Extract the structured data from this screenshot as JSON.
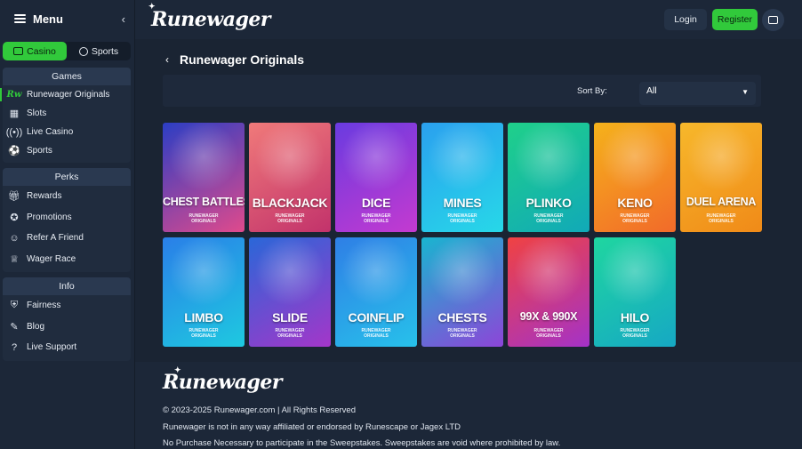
{
  "sidebar": {
    "title": "Menu",
    "modes": [
      {
        "label": "Casino",
        "active": true
      },
      {
        "label": "Sports",
        "active": false
      }
    ],
    "sections": [
      {
        "title": "Games",
        "items": [
          {
            "label": "Runewager Originals",
            "icon": "runewager-icon",
            "active": true
          },
          {
            "label": "Slots",
            "icon": "slots-icon"
          },
          {
            "label": "Live Casino",
            "icon": "live-casino-icon"
          },
          {
            "label": "Sports",
            "icon": "sports-ball-icon"
          }
        ]
      },
      {
        "title": "Perks",
        "items": [
          {
            "label": "Rewards",
            "icon": "gift-icon"
          },
          {
            "label": "Promotions",
            "icon": "promotions-icon"
          },
          {
            "label": "Refer A Friend",
            "icon": "refer-friend-icon"
          },
          {
            "label": "Wager Race",
            "icon": "trophy-icon"
          }
        ]
      },
      {
        "title": "Info",
        "items": [
          {
            "label": "Fairness",
            "icon": "shield-check-icon"
          },
          {
            "label": "Blog",
            "icon": "blog-icon"
          },
          {
            "label": "Live Support",
            "icon": "help-icon"
          }
        ]
      }
    ]
  },
  "header": {
    "logo": "Runewager",
    "login": "Login",
    "register": "Register"
  },
  "main": {
    "title": "Runewager Originals",
    "sort_label": "Sort By:",
    "sort_value": "All",
    "games": [
      {
        "name": "CHEST BATTLES",
        "sub": "RUNEWAGER\nORIGINALS",
        "colors": [
          "#2b3ec4",
          "#e04a8c"
        ]
      },
      {
        "name": "BLACKJACK",
        "sub": "RUNEWAGER\nORIGINALS",
        "colors": [
          "#f07a7a",
          "#c2326b"
        ]
      },
      {
        "name": "DICE",
        "sub": "RUNEWAGER\nORIGINALS",
        "colors": [
          "#6a3be0",
          "#c43ad0"
        ]
      },
      {
        "name": "MINES",
        "sub": "RUNEWAGER\nORIGINALS",
        "colors": [
          "#2aa0ef",
          "#27d8e8"
        ]
      },
      {
        "name": "PLINKO",
        "sub": "RUNEWAGER\nORIGINALS",
        "colors": [
          "#1fd08a",
          "#11a9b8"
        ]
      },
      {
        "name": "KENO",
        "sub": "RUNEWAGER\nORIGINALS",
        "colors": [
          "#f5b21b",
          "#f26a2a"
        ]
      },
      {
        "name": "DUEL ARENA",
        "sub": "RUNEWAGER\nORIGINALS",
        "colors": [
          "#f7b82b",
          "#f08a18"
        ]
      },
      {
        "name": "LIMBO",
        "sub": "RUNEWAGER\nORIGINALS",
        "colors": [
          "#2a7fe8",
          "#1ec9e0"
        ]
      },
      {
        "name": "SLIDE",
        "sub": "RUNEWAGER\nORIGINALS",
        "colors": [
          "#2a67d8",
          "#a436c9"
        ]
      },
      {
        "name": "COINFLIP",
        "sub": "RUNEWAGER\nORIGINALS",
        "colors": [
          "#2f7fe6",
          "#27c1ea"
        ]
      },
      {
        "name": "CHESTS",
        "sub": "RUNEWAGER\nORIGINALS",
        "colors": [
          "#19b5d0",
          "#8d45d8"
        ]
      },
      {
        "name": "99X & 990X",
        "sub": "RUNEWAGER\nORIGINALS",
        "colors": [
          "#f04242",
          "#a432c8"
        ]
      },
      {
        "name": "HILO",
        "sub": "RUNEWAGER\nORIGINALS",
        "colors": [
          "#1fd6a0",
          "#16a8c4"
        ]
      }
    ]
  },
  "footer": {
    "logo": "Runewager",
    "copyright": "© 2023-2025 Runewager.com | All Rights Reserved",
    "disclaimer1": "Runewager is not in any way affiliated or endorsed by Runescape or Jagex LTD",
    "disclaimer2": "No Purchase Necessary to participate in the Sweepstakes. Sweepstakes are void where prohibited by law."
  }
}
